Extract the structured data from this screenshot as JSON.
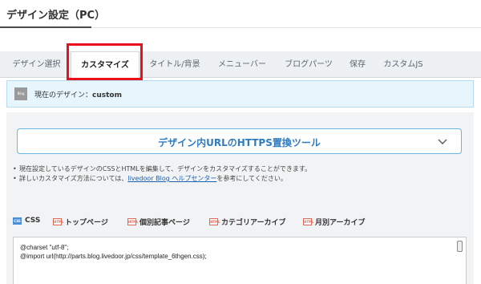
{
  "page": {
    "title": "デザイン設定（PC）"
  },
  "tabs": [
    {
      "label": "デザイン選択"
    },
    {
      "label": "カスタマイズ"
    },
    {
      "label": "タイトル/背景"
    },
    {
      "label": "メニューバー"
    },
    {
      "label": "ブログパーツ"
    },
    {
      "label": "保存"
    },
    {
      "label": "カスタムJS"
    }
  ],
  "current": {
    "thumb_text": "Blog",
    "label": "現在のデザイン：",
    "value": "custom"
  },
  "https_tool": {
    "label": "デザイン内URLのHTTPS置換ツール",
    "icon": "chevron-down-icon"
  },
  "notes": {
    "line1": "現在設定しているデザインのCSSとHTMLを編集して、デザインをカスタマイズすることができます。",
    "line2_pre": "詳しいカスタマイズ方法については、",
    "line2_link": "livedoor Blog ヘルプセンター",
    "line2_post": "を参考にしてください。"
  },
  "file_tabs": [
    {
      "icon": "CSS",
      "label": "CSS"
    },
    {
      "icon": "HTML",
      "label": "トップページ"
    },
    {
      "icon": "HTML",
      "label": "個別記事ページ"
    },
    {
      "icon": "HTML",
      "label": "カテゴリアーカイブ"
    },
    {
      "icon": "HTML",
      "label": "月別アーカイブ"
    }
  ],
  "editor": {
    "line1": "@charset \"utf-8\";",
    "line2": "@import url(http://parts.blog.livedoor.jp/css/template_6thgen.css);"
  },
  "colors": {
    "highlight": "#e8101c",
    "accent": "#2f7bbf",
    "link": "#1b5fb0"
  }
}
